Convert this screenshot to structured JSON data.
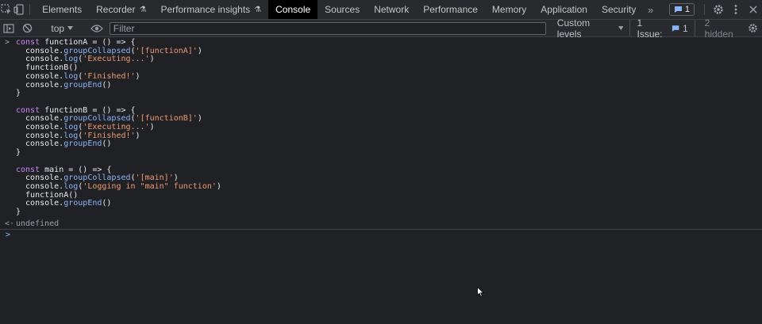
{
  "tabs": [
    {
      "label": "Elements"
    },
    {
      "label": "Recorder",
      "flask": "⚗"
    },
    {
      "label": "Performance insights",
      "flask": "⚗"
    },
    {
      "label": "Console"
    },
    {
      "label": "Sources"
    },
    {
      "label": "Network"
    },
    {
      "label": "Performance"
    },
    {
      "label": "Memory"
    },
    {
      "label": "Application"
    },
    {
      "label": "Security"
    }
  ],
  "more_tabs": "»",
  "message_badge": {
    "count": "1"
  },
  "toolbar": {
    "context": "top",
    "filter_placeholder": "Filter",
    "levels": "Custom levels",
    "issues_label": "1 Issue:",
    "issues_count": "1",
    "hidden": "2 hidden"
  },
  "console": {
    "input_prompt": ">",
    "result_prompt": "<·",
    "result": "undefined",
    "caret": ">"
  },
  "colors": {
    "accent": "#8ab4f8",
    "keyword": "#c58af9",
    "string": "#ee9a74",
    "background": "#202124"
  }
}
